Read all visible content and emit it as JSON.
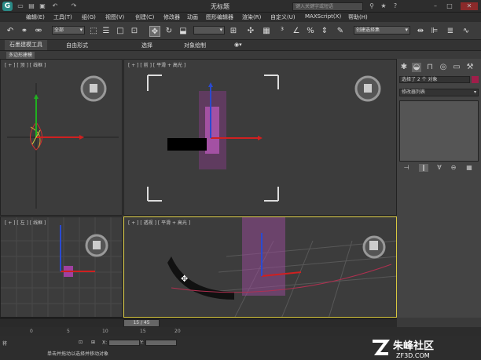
{
  "window": {
    "title": "无标题",
    "search_placeholder": "键入关键字或短语"
  },
  "menu": [
    "编辑(E)",
    "工具(T)",
    "组(G)",
    "视图(V)",
    "创建(C)",
    "修改器",
    "动画",
    "图形编辑器",
    "渲染(R)",
    "自定义(U)",
    "MAXScript(X)",
    "帮助(H)"
  ],
  "toolbar": {
    "selection_filter": "全部",
    "named_set": "创建选择集"
  },
  "ribbon": {
    "tabs": [
      "石墨建模工具",
      "自由形式",
      "选择",
      "对象绘制"
    ],
    "sub_tab": "多边形建模"
  },
  "viewports": {
    "top": "[ + ] [ 顶 ] [ 线框 ]",
    "front": "[ + ] [ 前 ] [ 平滑 + 高光 ]",
    "left": "[ + ] [ 左 ] [ 线框 ]",
    "perspective": "[ + ] [ 透视 ] [ 平滑 + 高光 ]"
  },
  "panel": {
    "selection": "选择了 2 个 对象",
    "modifier_list": "修改器列表",
    "accent": "#a01e4a"
  },
  "timeline": {
    "frame": "15 / 45"
  },
  "ruler": [
    "0",
    "5",
    "10",
    "15",
    "20"
  ],
  "status": {
    "x_label": "X:",
    "y_label": "Y:",
    "hint": "单击并拖动以选择并移动对象",
    "left": "将"
  },
  "watermark": {
    "brand": "朱峰社区",
    "url": "ZF3D.COM"
  }
}
